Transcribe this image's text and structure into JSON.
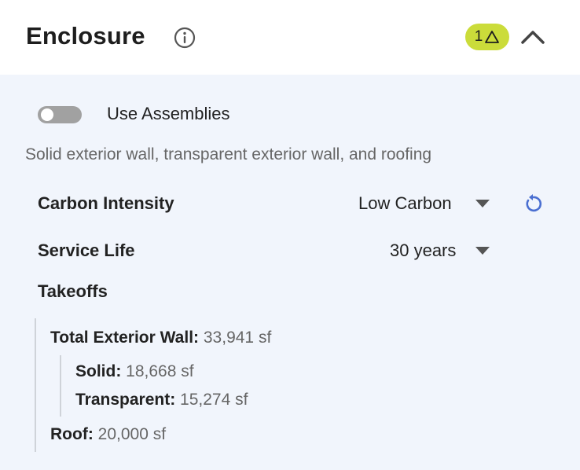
{
  "header": {
    "title": "Enclosure",
    "warning_count": "1"
  },
  "assemblies": {
    "toggle_label": "Use Assemblies",
    "enabled": false
  },
  "description": "Solid exterior wall, transparent exterior wall, and roofing",
  "carbon_intensity": {
    "label": "Carbon Intensity",
    "value": "Low Carbon"
  },
  "service_life": {
    "label": "Service Life",
    "value": "30 years"
  },
  "takeoffs": {
    "heading": "Takeoffs",
    "total_wall": {
      "label": "Total Exterior Wall:",
      "value": "33,941 sf"
    },
    "solid": {
      "label": "Solid:",
      "value": "18,668 sf"
    },
    "transparent": {
      "label": "Transparent:",
      "value": "15,274 sf"
    },
    "roof": {
      "label": "Roof:",
      "value": "20,000 sf"
    }
  },
  "colors": {
    "badge": "#cbdc3a",
    "panel_bg": "#f1f5fc",
    "reset_icon": "#4a6fd1"
  },
  "icons": [
    "info-icon",
    "warning-triangle-icon",
    "chevron-up-icon",
    "caret-down-icon",
    "reset-icon"
  ]
}
